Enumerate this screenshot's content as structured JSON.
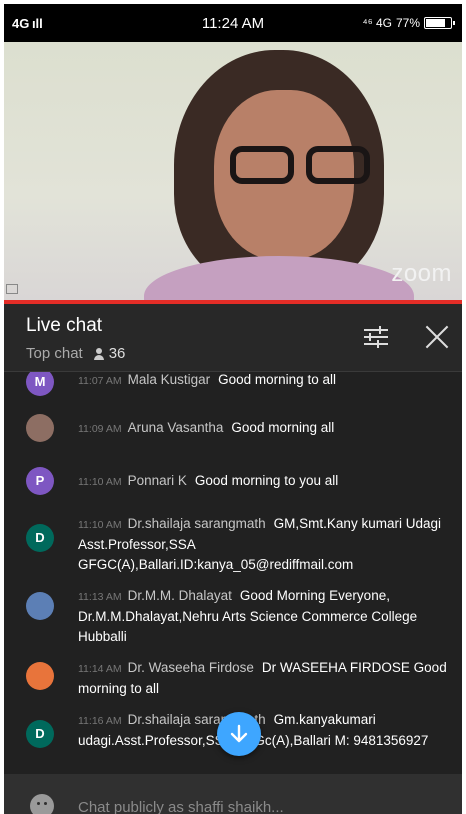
{
  "status_bar": {
    "signal": "4G ıll",
    "time": "11:24 AM",
    "network": "⁴⁶ 4G",
    "battery": "77%"
  },
  "video": {
    "watermark": "zoom"
  },
  "chat_header": {
    "title": "Live chat",
    "mode": "Top chat",
    "viewer_count": "36"
  },
  "messages": [
    {
      "avatar_letter": "M",
      "avatar_color": "#7e57c2",
      "time": "11:07 AM",
      "author": "Mala Kustigar",
      "text": "Good morning to all"
    },
    {
      "avatar_letter": "",
      "avatar_color": "#8d6e63",
      "time": "11:09 AM",
      "author": "Aruna Vasantha",
      "text": "Good morning all"
    },
    {
      "avatar_letter": "P",
      "avatar_color": "#7e57c2",
      "time": "11:10 AM",
      "author": "Ponnari K",
      "text": "Good morning to you all"
    },
    {
      "avatar_letter": "D",
      "avatar_color": "#00695c",
      "time": "11:10 AM",
      "author": "Dr.shailaja sarangmath",
      "text": "GM,Smt.Kany kumari Udagi Asst.Professor,SSA GFGC(A),Ballari.ID:kanya_05@rediffmail.com"
    },
    {
      "avatar_letter": "",
      "avatar_color": "#5c7fb5",
      "time": "11:13 AM",
      "author": "Dr.M.M. Dhalayat",
      "text": "Good Morning Everyone, Dr.M.M.Dhalayat,Nehru Arts Science Commerce College Hubballi"
    },
    {
      "avatar_letter": "",
      "avatar_color": "#e8743b",
      "time": "11:14 AM",
      "author": "Dr. Waseeha Firdose",
      "text": "Dr WASEEHA FIRDOSE Good morning to all"
    },
    {
      "avatar_letter": "D",
      "avatar_color": "#00695c",
      "time": "11:16 AM",
      "author": "Dr.shailaja sarangmath",
      "text": "Gm.kanyakumari udagi.Asst.Professor,SSA GFGc(A),Ballari M: 9481356927"
    }
  ],
  "input": {
    "placeholder": "Chat publicly as shaffi shaikh..."
  },
  "colors": {
    "progress_bar": "#e52d27",
    "scroll_button": "#3ea6ff"
  },
  "icons": {
    "filter": "sliders-icon",
    "close": "close-icon",
    "scroll_down": "arrow-down-icon",
    "emoji": "emoji-icon",
    "viewers": "person-icon"
  }
}
